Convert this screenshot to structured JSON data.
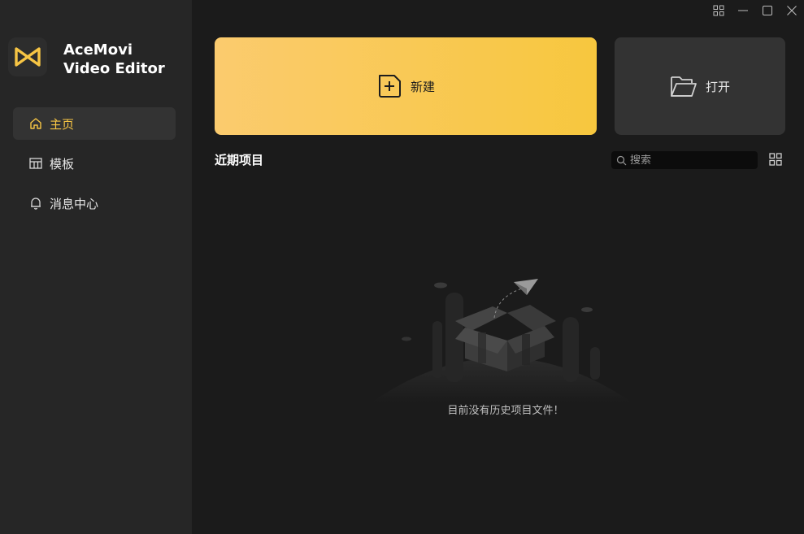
{
  "app": {
    "name_line1": "AceMovi",
    "name_line2": "Video Editor",
    "accent_color": "#f7c544",
    "logo_icon": "acemovi-logo-icon"
  },
  "window_controls": [
    {
      "name": "layout-icon"
    },
    {
      "name": "minimize-icon"
    },
    {
      "name": "maximize-icon"
    },
    {
      "name": "close-icon"
    }
  ],
  "sidebar": {
    "items": [
      {
        "label": "主页",
        "icon": "home-icon",
        "active": true
      },
      {
        "label": "模板",
        "icon": "template-icon",
        "active": false
      },
      {
        "label": "消息中心",
        "icon": "bell-icon",
        "active": false
      }
    ]
  },
  "main": {
    "new_card": {
      "label": "新建",
      "icon": "new-file-icon"
    },
    "open_card": {
      "label": "打开",
      "icon": "folder-open-icon"
    },
    "recent_title": "近期项目",
    "search": {
      "placeholder": "搜索",
      "value": ""
    },
    "view_toggle_icon": "grid-view-icon",
    "empty_message": "目前没有历史项目文件！"
  }
}
